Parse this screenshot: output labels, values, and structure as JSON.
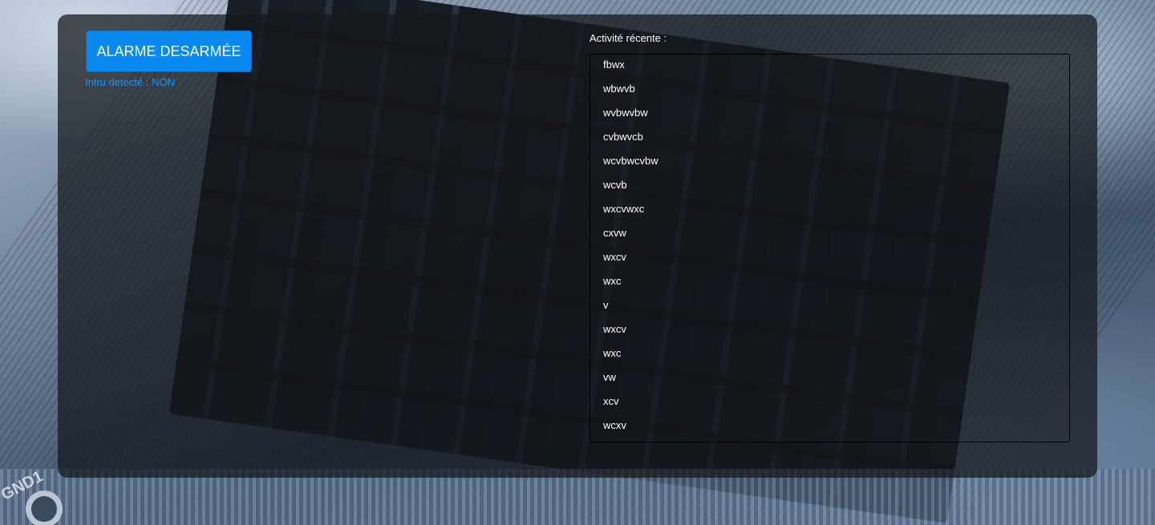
{
  "alarm": {
    "button_label": "ALARME DESARMÉE",
    "intrus_text": "Intru detecté : NON"
  },
  "activity": {
    "label": "Activité récente :",
    "items": [
      "fbwx",
      "wbwvb",
      "wvbwvbw",
      "cvbwvcb",
      "wcvbwcvbw",
      "wcvb",
      "wxcvwxc",
      "cxvw",
      "wxcv",
      "wxc",
      "v",
      "wxcv",
      "wxc",
      "vw",
      "xcv",
      "wcxv"
    ]
  },
  "background": {
    "board_text": "GND1"
  },
  "colors": {
    "accent": "#0a8af0",
    "status_text": "#1a90f2",
    "panel": "#16181c"
  }
}
